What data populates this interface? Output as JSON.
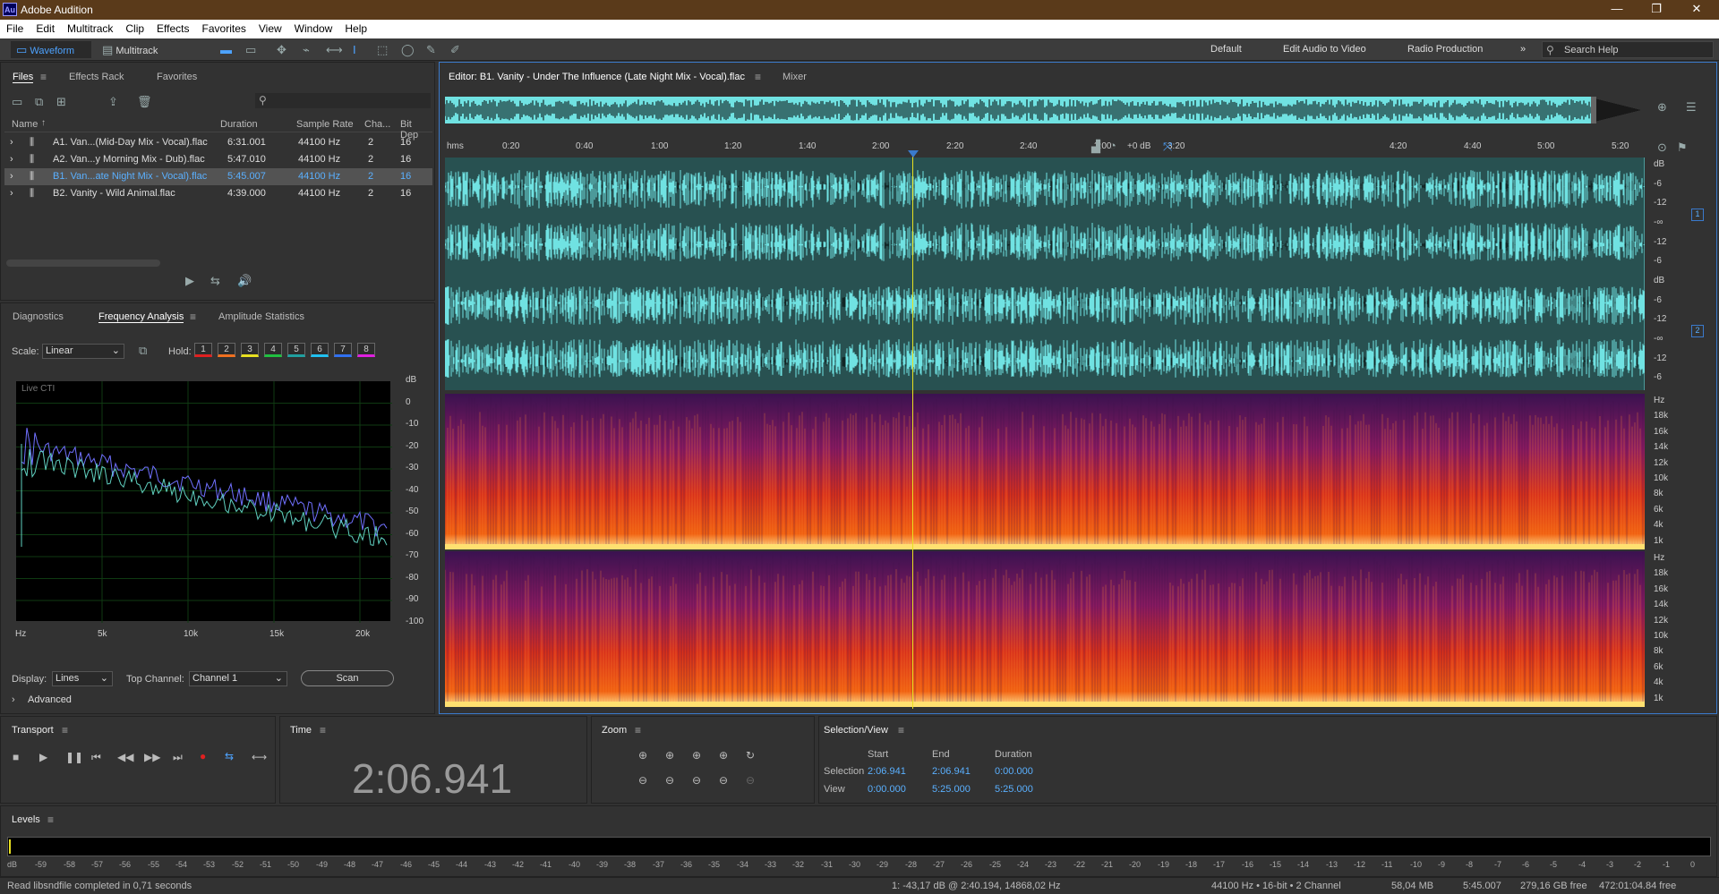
{
  "app": {
    "title": "Adobe Audition",
    "logo": "Au"
  },
  "menu": [
    "File",
    "Edit",
    "Multitrack",
    "Clip",
    "Effects",
    "Favorites",
    "View",
    "Window",
    "Help"
  ],
  "toolbar": {
    "waveform_label": "Waveform",
    "multitrack_label": "Multitrack",
    "workspaces": [
      "Default",
      "Edit Audio to Video",
      "Radio Production"
    ],
    "search_placeholder": "Search Help"
  },
  "files_panel": {
    "tabs": [
      "Files",
      "Effects Rack",
      "Favorites"
    ],
    "columns": [
      "Name",
      "Duration",
      "Sample Rate",
      "Cha...",
      "Bit Dep"
    ],
    "rows": [
      {
        "name": "A1. Van...(Mid-Day Mix - Vocal).flac",
        "duration": "6:31.001",
        "rate": "44100 Hz",
        "ch": "2",
        "bit": "16"
      },
      {
        "name": "A2. Van...y Morning Mix - Dub).flac",
        "duration": "5:47.010",
        "rate": "44100 Hz",
        "ch": "2",
        "bit": "16"
      },
      {
        "name": "B1. Van...ate Night Mix - Vocal).flac",
        "duration": "5:45.007",
        "rate": "44100 Hz",
        "ch": "2",
        "bit": "16",
        "selected": true
      },
      {
        "name": "B2. Vanity - Wild Animal.flac",
        "duration": "4:39.000",
        "rate": "44100 Hz",
        "ch": "2",
        "bit": "16"
      }
    ]
  },
  "analysis_panel": {
    "tabs": [
      "Diagnostics",
      "Frequency Analysis",
      "Amplitude Statistics"
    ],
    "scale_label": "Scale:",
    "scale_value": "Linear",
    "hold_label": "Hold:",
    "holds": [
      "1",
      "2",
      "3",
      "4",
      "5",
      "6",
      "7",
      "8"
    ],
    "hold_colors": [
      "#e02020",
      "#f07020",
      "#e8e020",
      "#20c040",
      "#20a0a0",
      "#20c0f0",
      "#3070f0",
      "#e020e0"
    ],
    "graph_label": "Live CTI",
    "db_ticks": [
      "dB",
      "0",
      "-10",
      "-20",
      "-30",
      "-40",
      "-50",
      "-60",
      "-70",
      "-80",
      "-90",
      "-100"
    ],
    "hz_ticks": [
      "Hz",
      "5k",
      "10k",
      "15k",
      "20k"
    ],
    "display_label": "Display:",
    "display_value": "Lines",
    "top_channel_label": "Top Channel:",
    "top_channel_value": "Channel 1",
    "scan_label": "Scan",
    "advanced_label": "Advanced"
  },
  "editor": {
    "tab_title": "Editor: B1. Vanity - Under The Influence (Late Night Mix - Vocal).flac",
    "mixer_label": "Mixer",
    "ruler_unit": "hms",
    "ruler_ticks": [
      "0:20",
      "0:40",
      "1:00",
      "1:20",
      "1:40",
      "2:00",
      "2:20",
      "2:40",
      "3:00",
      "3:20",
      "4:20",
      "4:40",
      "5:00",
      "5:20"
    ],
    "gain": "+0 dB",
    "db_scale": [
      "dB",
      "-6",
      "-12",
      "-∞",
      "-12",
      "-6"
    ],
    "hz_scale": [
      "Hz",
      "18k",
      "16k",
      "14k",
      "12k",
      "10k",
      "8k",
      "6k",
      "4k",
      "1k"
    ],
    "channel_labels": [
      "1",
      "2"
    ]
  },
  "transport": {
    "title": "Transport"
  },
  "time_panel": {
    "title": "Time",
    "value": "2:06.941"
  },
  "zoom_panel": {
    "title": "Zoom"
  },
  "selection_panel": {
    "title": "Selection/View",
    "headers": [
      "Start",
      "End",
      "Duration"
    ],
    "selection_label": "Selection",
    "view_label": "View",
    "selection": [
      "2:06.941",
      "2:06.941",
      "0:00.000"
    ],
    "view": [
      "0:00.000",
      "5:25.000",
      "5:25.000"
    ]
  },
  "levels": {
    "title": "Levels",
    "ticks": [
      "dB",
      "-59",
      "-58",
      "-57",
      "-56",
      "-55",
      "-54",
      "-53",
      "-52",
      "-51",
      "-50",
      "-49",
      "-48",
      "-47",
      "-46",
      "-45",
      "-44",
      "-43",
      "-42",
      "-41",
      "-40",
      "-39",
      "-38",
      "-37",
      "-36",
      "-35",
      "-34",
      "-33",
      "-32",
      "-31",
      "-30",
      "-29",
      "-28",
      "-27",
      "-26",
      "-25",
      "-24",
      "-23",
      "-22",
      "-21",
      "-20",
      "-19",
      "-18",
      "-17",
      "-16",
      "-15",
      "-14",
      "-13",
      "-12",
      "-11",
      "-10",
      "-9",
      "-8",
      "-7",
      "-6",
      "-5",
      "-4",
      "-3",
      "-2",
      "-1",
      "0"
    ]
  },
  "status": {
    "message": "Read libsndfile completed in 0,71 seconds",
    "cursor": "1: -43,17 dB @ 2:40.194, 14868,02 Hz",
    "format": "44100 Hz • 16-bit • 2 Channel",
    "size": "58,04 MB",
    "duration": "5:45.007",
    "free": "279,16 GB free",
    "free_time": "472:01:04.84 free"
  },
  "colors": {
    "accent": "#5ab0ff",
    "waveform": "#74e4e4",
    "titlebar": "#5a3a1a",
    "playhead": "#e8e020"
  }
}
